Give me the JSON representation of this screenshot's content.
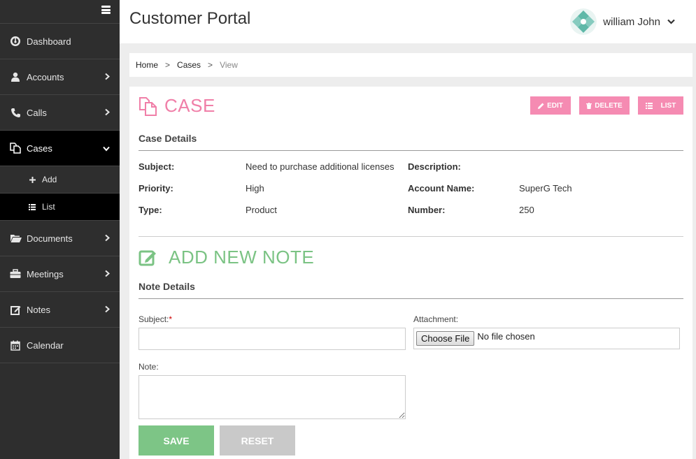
{
  "header": {
    "title": "Customer Portal",
    "user_name": "william John"
  },
  "sidebar": {
    "items": [
      {
        "label": "Dashboard"
      },
      {
        "label": "Accounts"
      },
      {
        "label": "Calls"
      },
      {
        "label": "Cases"
      },
      {
        "label": "Documents"
      },
      {
        "label": "Meetings"
      },
      {
        "label": "Notes"
      },
      {
        "label": "Calendar"
      }
    ],
    "cases_sub": {
      "add": "Add",
      "list": "List"
    }
  },
  "breadcrumb": {
    "home": "Home",
    "cases": "Cases",
    "current": "View",
    "sep": ">"
  },
  "case": {
    "title": "CASE",
    "buttons": {
      "edit": "EDIT",
      "delete": "DELETE",
      "list": "LIST"
    },
    "details_heading": "Case Details",
    "fields": {
      "subject_label": "Subject:",
      "subject_value": "Need to purchase additional licenses",
      "description_label": "Description:",
      "description_value": "",
      "priority_label": "Priority:",
      "priority_value": "High",
      "account_label": "Account Name:",
      "account_value": "SuperG Tech",
      "type_label": "Type:",
      "type_value": "Product",
      "number_label": "Number:",
      "number_value": "250"
    }
  },
  "note": {
    "title": "ADD NEW NOTE",
    "details_heading": "Note Details",
    "subject_label": "Subject:",
    "required_mark": "*",
    "subject_value": "",
    "attachment_label": "Attachment:",
    "choose_file": "Choose File",
    "no_file": "No file chosen",
    "note_label": "Note:",
    "note_value": "",
    "save": "SAVE",
    "reset": "RESET"
  },
  "colors": {
    "case_accent": "#f07fa8",
    "note_accent": "#7bc384",
    "sidebar_bg": "#2e2e2e",
    "sidebar_active": "#000000"
  }
}
